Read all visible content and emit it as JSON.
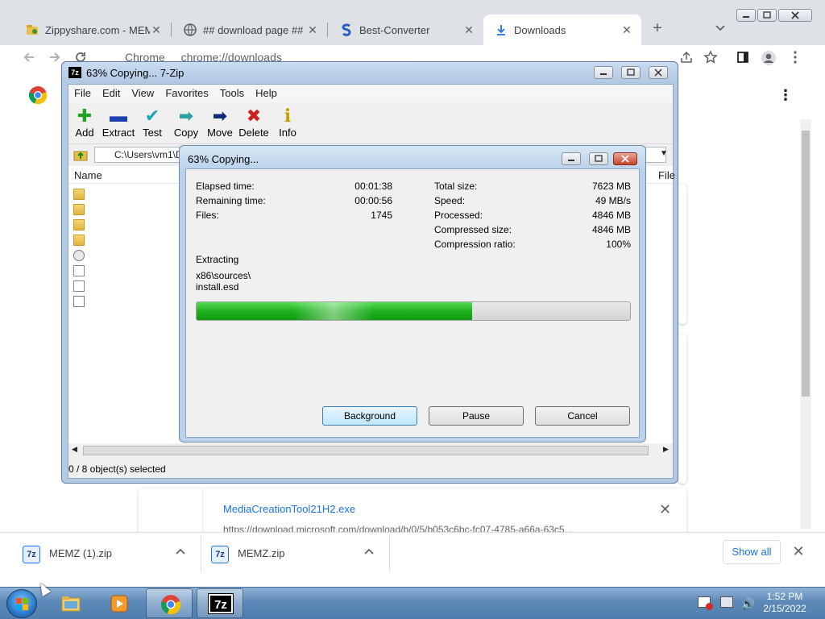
{
  "chrome": {
    "tabs": [
      {
        "title": "Zippyshare.com - MEMZ",
        "icon": "zippyshare-icon",
        "active": false
      },
      {
        "title": "## download page ##",
        "icon": "globe-icon",
        "active": false
      },
      {
        "title": "Best-Converter",
        "icon": "best-converter-icon",
        "active": false
      },
      {
        "title": "Downloads",
        "icon": "download-icon",
        "active": true
      }
    ],
    "new_tab": "+",
    "tab_close": "✕",
    "address_scheme": "Chrome",
    "address_url": "chrome://downloads",
    "page_menu": "⋮",
    "download_card": {
      "filename": "MediaCreationTool21H2.exe",
      "url": "https://download.microsoft.com/download/b/0/5/b053c6bc-fc07-4785-a66a-63c5..."
    },
    "shelf": {
      "items": [
        {
          "name": "MEMZ (1).zip"
        },
        {
          "name": "MEMZ.zip"
        }
      ],
      "show_all": "Show all",
      "close": "✕"
    }
  },
  "zip": {
    "title": "63% Copying... 7-Zip",
    "menu": [
      "File",
      "Edit",
      "View",
      "Favorites",
      "Tools",
      "Help"
    ],
    "toolbar": [
      {
        "label": "Add",
        "icon": "plus-icon",
        "glyph": "✚",
        "color": "#1fa51f"
      },
      {
        "label": "Extract",
        "icon": "minus-icon",
        "glyph": "▬",
        "color": "#1f3fb5"
      },
      {
        "label": "Test",
        "icon": "check-icon",
        "glyph": "✔",
        "color": "#1aa6b6"
      },
      {
        "label": "Copy",
        "icon": "copy-arrow-icon",
        "glyph": "➡",
        "color": "#2aa0a0"
      },
      {
        "label": "Move",
        "icon": "move-arrow-icon",
        "glyph": "➡",
        "color": "#102a7a"
      },
      {
        "label": "Delete",
        "icon": "delete-x-icon",
        "glyph": "✖",
        "color": "#d21f1f"
      },
      {
        "label": "Info",
        "icon": "info-icon",
        "glyph": "i",
        "color": "#c8a000"
      }
    ],
    "path": "C:\\Users\\vm1\\D",
    "column_name": "Name",
    "column_file": "File",
    "status": "0 / 8 object(s) selected"
  },
  "progress": {
    "title": "63% Copying...",
    "elapsed_label": "Elapsed time:",
    "elapsed_value": "00:01:38",
    "remaining_label": "Remaining time:",
    "remaining_value": "00:00:56",
    "files_label": "Files:",
    "files_value": "1745",
    "total_label": "Total size:",
    "total_value": "7623 MB",
    "speed_label": "Speed:",
    "speed_value": "49 MB/s",
    "processed_label": "Processed:",
    "processed_value": "4846 MB",
    "compressed_label": "Compressed size:",
    "compressed_value": "4846 MB",
    "ratio_label": "Compression ratio:",
    "ratio_value": "100%",
    "action": "Extracting",
    "current_path": "x86\\sources\\",
    "current_file": "install.esd",
    "progress_fraction": 0.636,
    "buttons": {
      "background": "Background",
      "pause": "Pause",
      "cancel": "Cancel"
    }
  },
  "taskbar": {
    "time": "1:52 PM",
    "date": "2/15/2022",
    "apps": [
      "explorer",
      "media-player",
      "chrome",
      "7-zip"
    ]
  }
}
